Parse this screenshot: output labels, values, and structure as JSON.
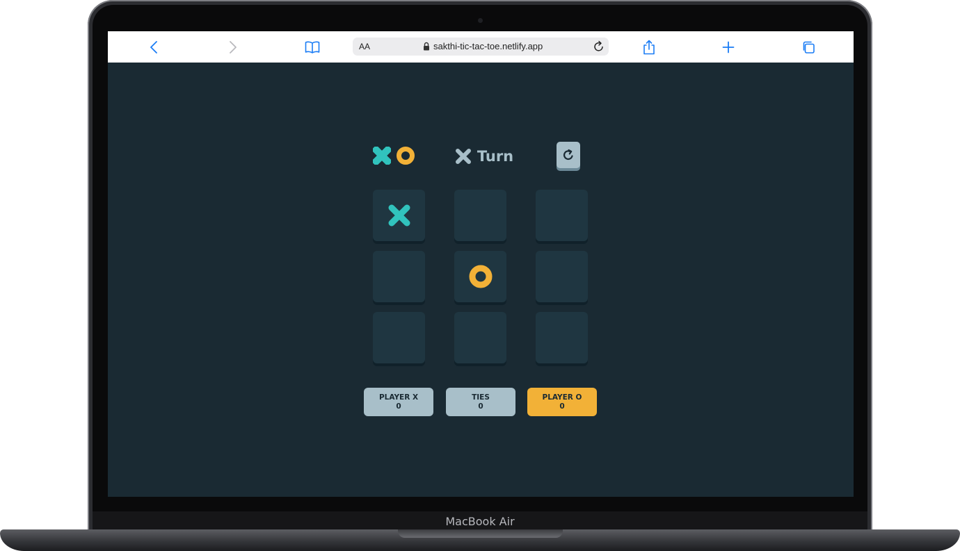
{
  "browser": {
    "text_size_label": "AA",
    "url": "sakthi-tic-tac-toe.netlify.app"
  },
  "device": {
    "model_label": "MacBook Air"
  },
  "colors": {
    "x": "#31c3bd",
    "o": "#f2b137",
    "neutral": "#a8bfc9",
    "background": "#1a2a33",
    "cell": "#1f3641"
  },
  "game": {
    "turn": {
      "mark": "X",
      "label": "Turn"
    },
    "board": [
      "X",
      "",
      "",
      "",
      "O",
      "",
      "",
      "",
      ""
    ],
    "scores": [
      {
        "label": "PLAYER X",
        "value": "0",
        "color": "#a8bfc9"
      },
      {
        "label": "TIES",
        "value": "0",
        "color": "#a8bfc9"
      },
      {
        "label": "PLAYER O",
        "value": "0",
        "color": "#f2b137"
      }
    ]
  }
}
